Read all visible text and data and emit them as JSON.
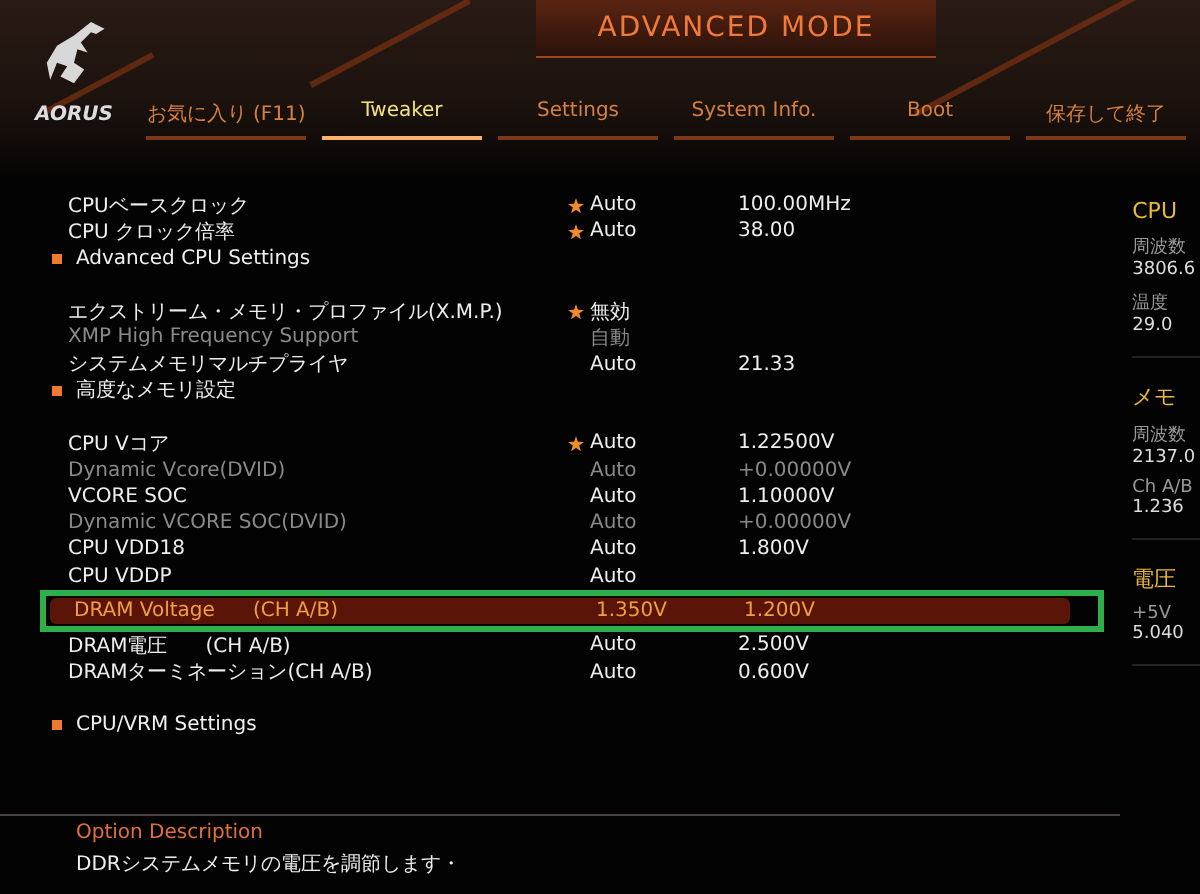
{
  "header": {
    "logo_text": "AORUS",
    "title": "ADVANCED MODE"
  },
  "tabs": [
    {
      "label": "お気に入り (F11)",
      "selected": false
    },
    {
      "label": "Tweaker",
      "selected": true
    },
    {
      "label": "Settings",
      "selected": false
    },
    {
      "label": "System Info.",
      "selected": false
    },
    {
      "label": "Boot",
      "selected": false
    },
    {
      "label": "保存して終了",
      "selected": false
    }
  ],
  "rows": [
    {
      "kind": "setting",
      "label": "CPUベースクロック",
      "starred": true,
      "mode": "Auto",
      "value": "100.00MHz",
      "dim": false,
      "selected": false
    },
    {
      "kind": "setting",
      "label": "CPU クロック倍率",
      "starred": true,
      "mode": "Auto",
      "value": "38.00",
      "dim": false,
      "selected": false
    },
    {
      "kind": "submenu",
      "label": "Advanced CPU Settings"
    },
    {
      "kind": "gap"
    },
    {
      "kind": "setting",
      "label": "エクストリーム・メモリ・プロファイル(X.M.P.)",
      "starred": true,
      "mode": "無効",
      "dim": false,
      "selected": false
    },
    {
      "kind": "setting",
      "label": "XMP High Frequency Support",
      "starred": false,
      "mode": "自動",
      "dim": true,
      "selected": false
    },
    {
      "kind": "setting",
      "label": "システムメモリマルチプライヤ",
      "starred": false,
      "mode": "Auto",
      "value": "21.33",
      "dim": false,
      "selected": false
    },
    {
      "kind": "submenu",
      "label": "高度なメモリ設定"
    },
    {
      "kind": "gap"
    },
    {
      "kind": "setting",
      "label": "CPU Vコア",
      "starred": true,
      "mode": "Auto",
      "value": "1.22500V",
      "dim": false,
      "selected": false
    },
    {
      "kind": "setting",
      "label": "Dynamic Vcore(DVID)",
      "starred": false,
      "mode": "Auto",
      "value": "+0.00000V",
      "dim": true,
      "selected": false
    },
    {
      "kind": "setting",
      "label": "VCORE SOC",
      "starred": false,
      "mode": "Auto",
      "value": "1.10000V",
      "dim": false,
      "selected": false
    },
    {
      "kind": "setting",
      "label": "Dynamic VCORE SOC(DVID)",
      "starred": false,
      "mode": "Auto",
      "value": "+0.00000V",
      "dim": true,
      "selected": false
    },
    {
      "kind": "setting",
      "label": "CPU VDD18",
      "starred": false,
      "mode": "Auto",
      "value": "1.800V",
      "dim": false,
      "selected": false
    },
    {
      "kind": "setting",
      "label": "CPU VDDP",
      "starred": false,
      "mode": "Auto",
      "dim": false,
      "selected": false
    },
    {
      "kind": "setting",
      "label": "DRAM Voltage      (CH A/B)",
      "starred": false,
      "mode": "1.350V",
      "value": "1.200V",
      "dim": false,
      "selected": true
    },
    {
      "kind": "setting",
      "label": "DRAM電圧      (CH A/B)",
      "starred": false,
      "mode": "Auto",
      "value": "2.500V",
      "dim": false,
      "selected": false
    },
    {
      "kind": "setting",
      "label": "DRAMターミネーション(CH A/B)",
      "starred": false,
      "mode": "Auto",
      "value": "0.600V",
      "dim": false,
      "selected": false
    },
    {
      "kind": "gap"
    },
    {
      "kind": "submenu",
      "label": "CPU/VRM Settings"
    }
  ],
  "monitor": [
    {
      "heading": "CPU",
      "items": [
        {
          "label": "周波数",
          "value": "3806.6"
        },
        {
          "label": "温度",
          "value": "29.0"
        }
      ]
    },
    {
      "heading": "メモ",
      "items": [
        {
          "label": "周波数",
          "value": "2137.0"
        },
        {
          "label": "Ch A/B",
          "value": "1.236"
        }
      ]
    },
    {
      "heading": "電圧",
      "items": [
        {
          "label": "+5V",
          "value": "5.040"
        }
      ]
    }
  ],
  "description": {
    "heading": "Option Description",
    "text": "DDRシステムメモリの電圧を調節します・"
  }
}
